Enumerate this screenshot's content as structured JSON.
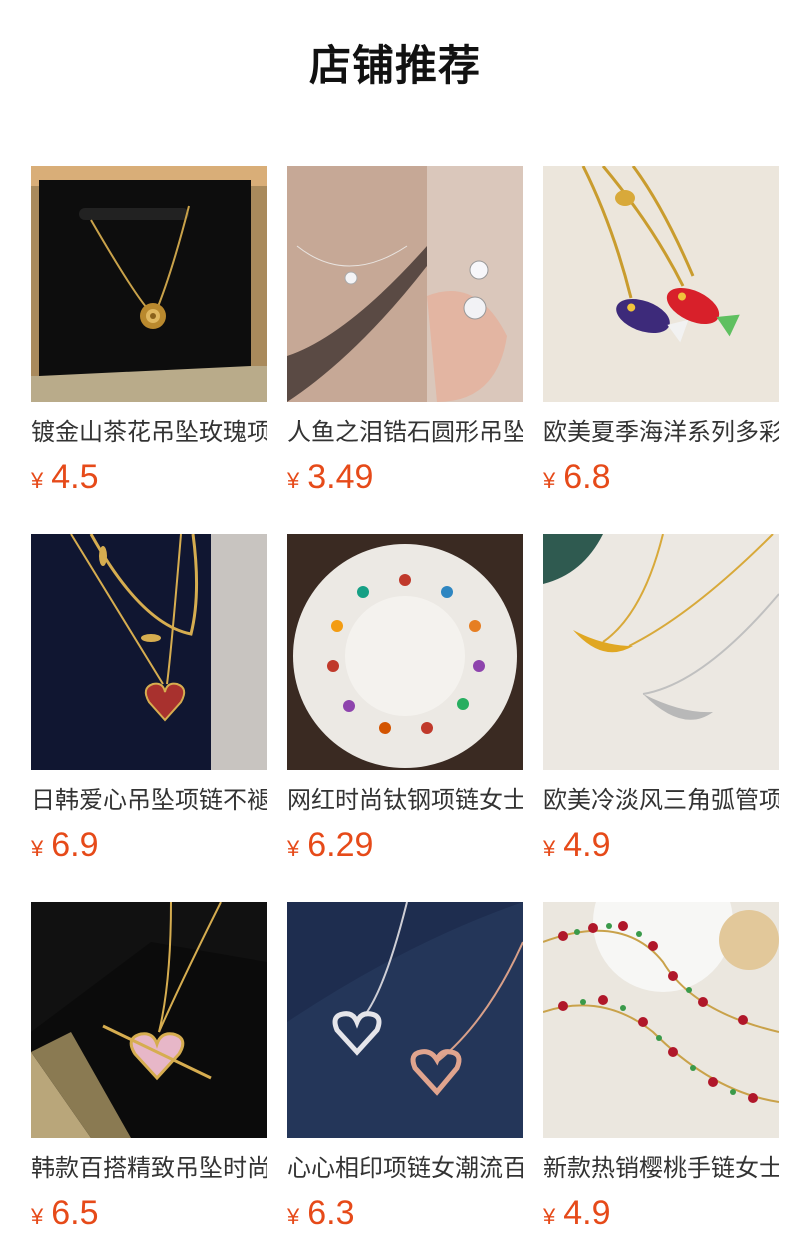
{
  "header": {
    "title": "店铺推荐"
  },
  "products": [
    {
      "name": "镀金山茶花吊坠玫瑰项链",
      "currency": "¥",
      "price": "4.5",
      "icon": "rose-necklace-image"
    },
    {
      "name": "人鱼之泪锆石圆形吊坠项链",
      "currency": "¥",
      "price": "3.49",
      "icon": "crystal-necklace-image"
    },
    {
      "name": "欧美夏季海洋系列多彩小鱼项链",
      "currency": "¥",
      "price": "6.8",
      "icon": "fish-necklace-image"
    },
    {
      "name": "日韩爱心吊坠项链不褪色",
      "currency": "¥",
      "price": "6.9",
      "icon": "heart-necklace-image"
    },
    {
      "name": "网红时尚钛钢项链女士吊坠",
      "currency": "¥",
      "price": "6.29",
      "icon": "plate-necklaces-image"
    },
    {
      "name": "欧美冷淡风三角弧管项链",
      "currency": "¥",
      "price": "4.9",
      "icon": "curve-tube-necklace-image"
    },
    {
      "name": "韩款百搭精致吊坠时尚项链",
      "currency": "¥",
      "price": "6.5",
      "icon": "arrow-heart-necklace-image"
    },
    {
      "name": "心心相印项链女潮流百搭",
      "currency": "¥",
      "price": "6.3",
      "icon": "linked-hearts-necklace-image"
    },
    {
      "name": "新款热销樱桃手链女士饰品",
      "currency": "¥",
      "price": "4.9",
      "icon": "cherry-bracelet-image"
    }
  ]
}
